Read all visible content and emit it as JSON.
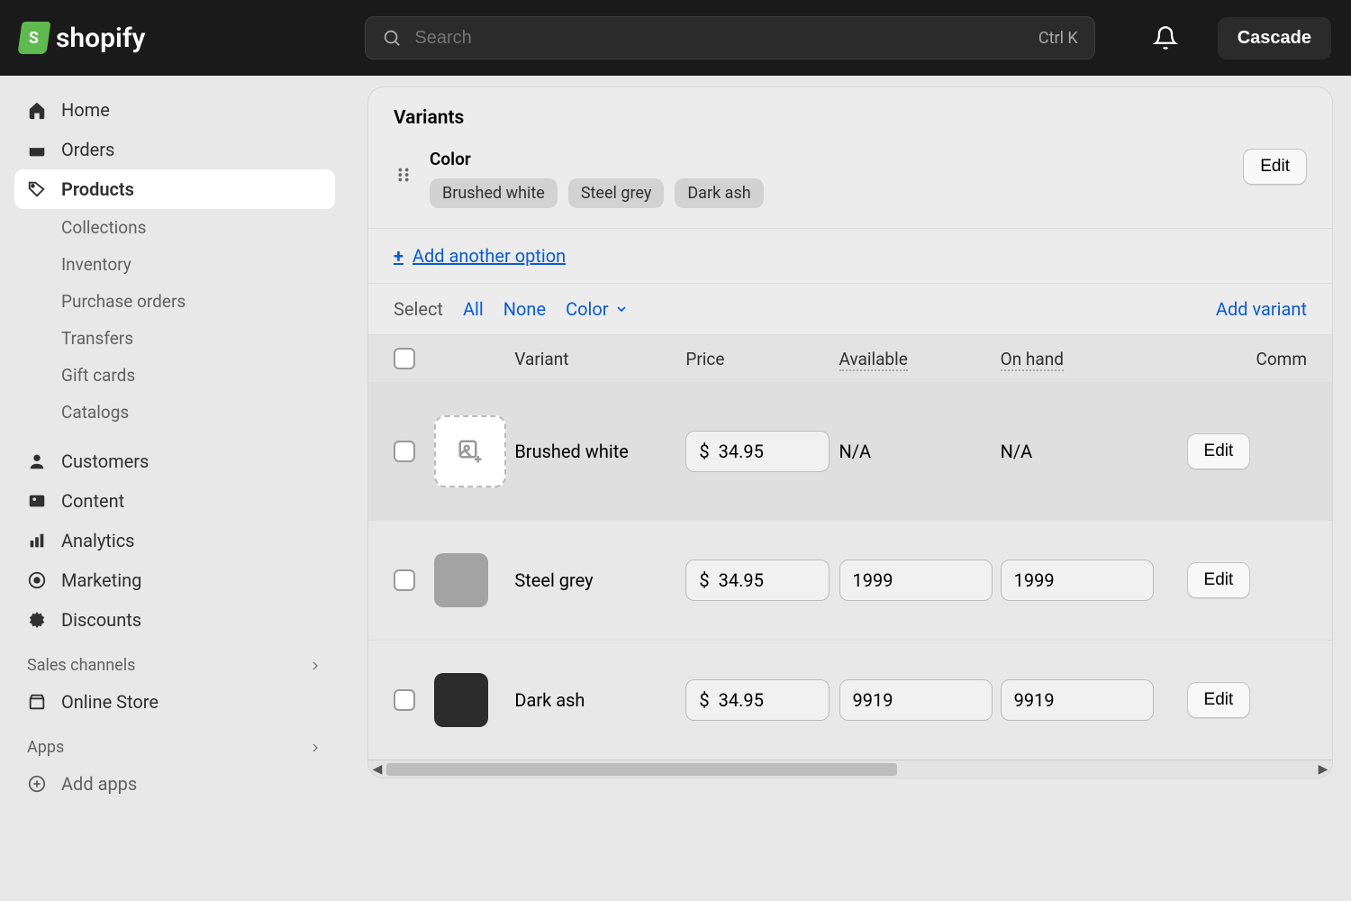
{
  "topbar": {
    "brand": "shopify",
    "search_placeholder": "Search",
    "search_shortcut": "Ctrl K",
    "store_button": "Cascade"
  },
  "sidebar": {
    "items": [
      {
        "label": "Home"
      },
      {
        "label": "Orders"
      },
      {
        "label": "Products",
        "active": true
      },
      {
        "label": "Customers"
      },
      {
        "label": "Content"
      },
      {
        "label": "Analytics"
      },
      {
        "label": "Marketing"
      },
      {
        "label": "Discounts"
      }
    ],
    "product_sub": [
      {
        "label": "Collections"
      },
      {
        "label": "Inventory"
      },
      {
        "label": "Purchase orders"
      },
      {
        "label": "Transfers"
      },
      {
        "label": "Gift cards"
      },
      {
        "label": "Catalogs"
      }
    ],
    "sales_label": "Sales channels",
    "sales_items": [
      {
        "label": "Online Store"
      }
    ],
    "apps_label": "Apps",
    "add_apps": "Add apps"
  },
  "variants": {
    "title": "Variants",
    "option_name": "Color",
    "option_values": [
      "Brushed white",
      "Steel grey",
      "Dark ash"
    ],
    "edit_label": "Edit",
    "add_option": "Add another option",
    "select_label": "Select",
    "select_all": "All",
    "select_none": "None",
    "select_color": "Color",
    "add_variant": "Add variant",
    "headers": {
      "variant": "Variant",
      "price": "Price",
      "available": "Available",
      "on_hand": "On hand",
      "comm": "Comm"
    },
    "currency": "$",
    "rows": [
      {
        "name": "Brushed white",
        "price": "34.95",
        "available": "N/A",
        "on_hand": "N/A",
        "thumb": "empty",
        "edit": "Edit"
      },
      {
        "name": "Steel grey",
        "price": "34.95",
        "available": "1999",
        "on_hand": "1999",
        "thumb": "grey",
        "edit": "Edit"
      },
      {
        "name": "Dark ash",
        "price": "34.95",
        "available": "9919",
        "on_hand": "9919",
        "thumb": "dark",
        "edit": "Edit"
      }
    ]
  }
}
